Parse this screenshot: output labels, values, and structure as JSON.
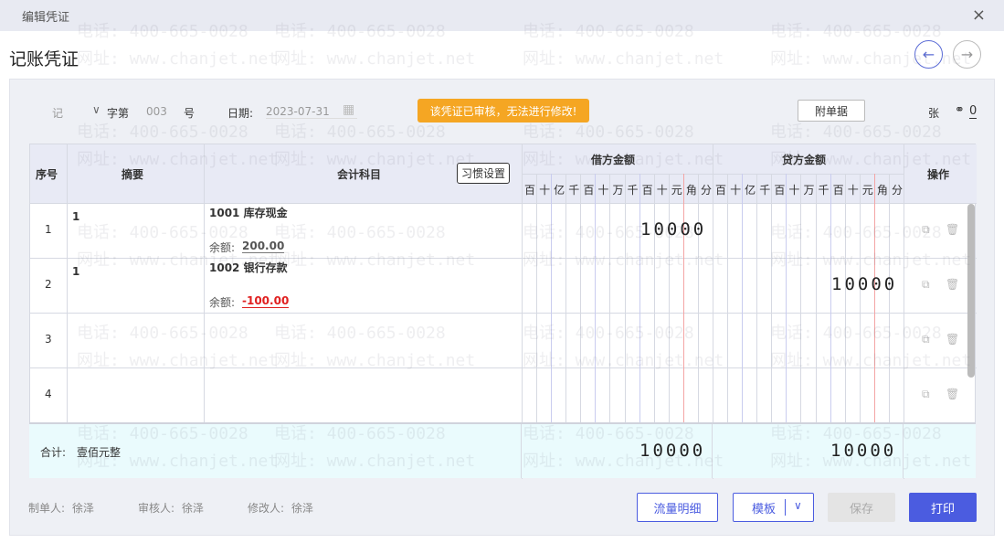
{
  "window": {
    "title": "编辑凭证",
    "close": "×"
  },
  "page_title": "记账凭证",
  "nav": {
    "prev": "←",
    "next": "→"
  },
  "header": {
    "voucher_type": "记",
    "word_label": "字第",
    "number": "003",
    "number_suffix": "号",
    "date_label": "日期:",
    "date_value": "2023-07-31",
    "audit_badge": "该凭证已审核，无法进行修改!",
    "attachment_button": "附单据",
    "sheet_label": "张",
    "link_count": "0"
  },
  "table": {
    "headers": {
      "index": "序号",
      "summary": "摘要",
      "account": "会计科目",
      "habit_settings": "习惯设置",
      "debit": "借方金额",
      "credit": "贷方金额",
      "actions": "操作"
    },
    "digit_units": [
      "百",
      "十",
      "亿",
      "千",
      "百",
      "十",
      "万",
      "千",
      "百",
      "十",
      "元",
      "角",
      "分"
    ],
    "rows": [
      {
        "index": "1",
        "summary": "1",
        "account": "1001 库存现金",
        "balance_label": "余额:",
        "balance": "200.00",
        "debit": "10000",
        "credit": ""
      },
      {
        "index": "2",
        "summary": "1",
        "account": "1002 银行存款",
        "balance_label": "余额:",
        "balance": "-100.00",
        "debit": "",
        "credit": "10000"
      },
      {
        "index": "3",
        "summary": "",
        "account": "",
        "balance_label": "",
        "balance": "",
        "debit": "",
        "credit": ""
      },
      {
        "index": "4",
        "summary": "",
        "account": "",
        "balance_label": "",
        "balance": "",
        "debit": "",
        "credit": ""
      }
    ],
    "total": {
      "label": "合计:",
      "text": "壹佰元整",
      "debit": "10000",
      "credit": "10000"
    }
  },
  "footer": {
    "maker_label": "制单人:",
    "maker": "徐泽",
    "auditor_label": "审核人:",
    "auditor": "徐泽",
    "modifier_label": "修改人:",
    "modifier": "徐泽"
  },
  "buttons": {
    "flow_detail": "流量明细",
    "template": "模板",
    "save": "保存",
    "print": "打印"
  },
  "watermark": {
    "phone": "电话: 400-665-0028",
    "site": "网址: www.chanjet.net"
  },
  "colors": {
    "primary": "#4b5ce0",
    "badge": "#f5a623",
    "negative": "#e02020"
  }
}
